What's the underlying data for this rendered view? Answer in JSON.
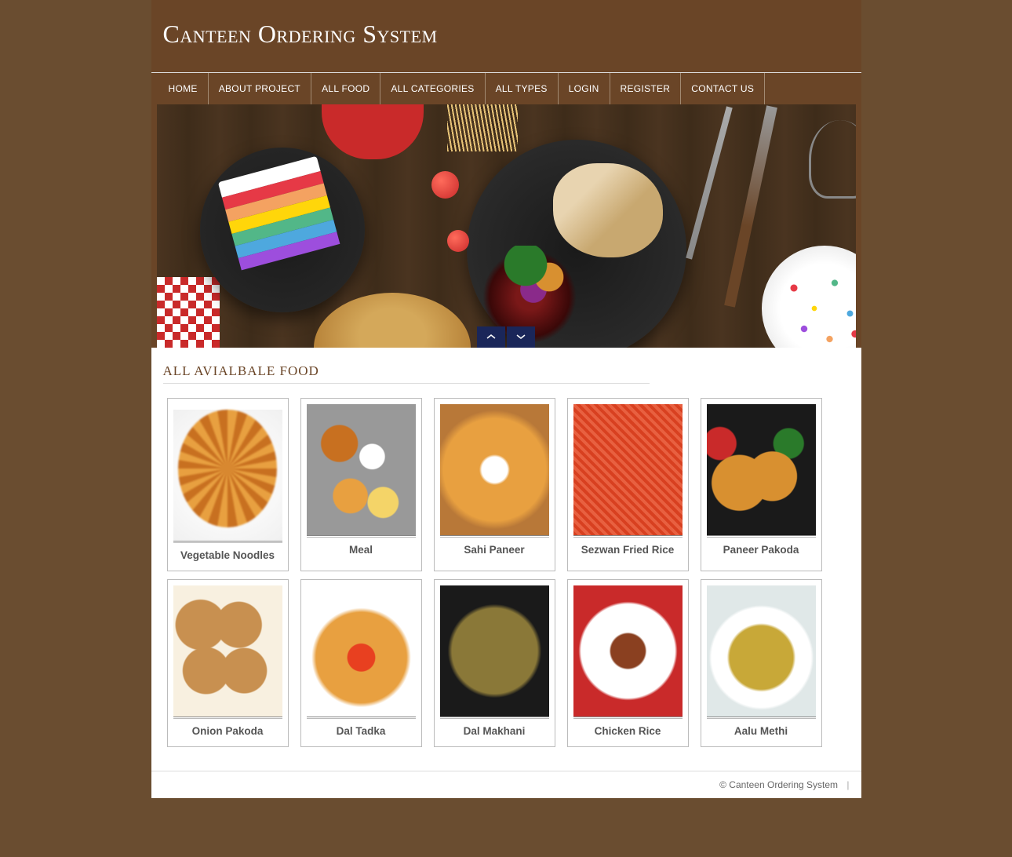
{
  "site": {
    "title": "Canteen Ordering System"
  },
  "nav": {
    "items": [
      {
        "label": "HOME"
      },
      {
        "label": "ABOUT PROJECT"
      },
      {
        "label": "ALL FOOD"
      },
      {
        "label": "ALL CATEGORIES"
      },
      {
        "label": "ALL TYPES"
      },
      {
        "label": "LOGIN"
      },
      {
        "label": "REGISTER"
      },
      {
        "label": "CONTACT US"
      }
    ]
  },
  "slider": {
    "prev_icon": "chevron-up",
    "next_icon": "chevron-down"
  },
  "section": {
    "title": "ALL AVIALBALE FOOD"
  },
  "foods": [
    {
      "name": "Vegetable Noodles",
      "thumb": "thumb-noodles"
    },
    {
      "name": "Meal",
      "thumb": "thumb-meal"
    },
    {
      "name": "Sahi Paneer",
      "thumb": "thumb-sahi"
    },
    {
      "name": "Sezwan Fried Rice",
      "thumb": "thumb-sezwan"
    },
    {
      "name": "Paneer Pakoda",
      "thumb": "thumb-pakoda"
    },
    {
      "name": "Onion Pakoda",
      "thumb": "thumb-onion"
    },
    {
      "name": "Dal Tadka",
      "thumb": "thumb-daltadka"
    },
    {
      "name": "Dal Makhani",
      "thumb": "thumb-dalmakhani"
    },
    {
      "name": "Chicken Rice",
      "thumb": "thumb-chicken"
    },
    {
      "name": "Aalu Methi",
      "thumb": "thumb-aalu"
    }
  ],
  "footer": {
    "copyright": "© Canteen Ordering System"
  }
}
